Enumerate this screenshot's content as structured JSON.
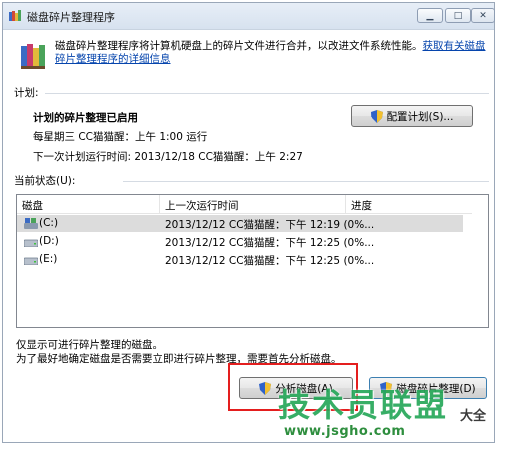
{
  "window": {
    "title": "磁盘碎片整理程序",
    "min_icon": "minimize-icon",
    "max_icon": "maximize-icon",
    "close_icon": "close-icon",
    "min_glyph": "▁",
    "max_glyph": "□",
    "close_glyph": "✕"
  },
  "intro": {
    "text": "磁盘碎片整理程序将计算机硬盘上的碎片文件进行合并，以改进文件系统性能。",
    "link": "获取有关磁盘碎片整理程序的详细信息"
  },
  "schedule": {
    "section_label": "计划:",
    "status": "计划的碎片整理已启用",
    "run_info": "每星期三  CC猫猫醒：上午 1:00 运行",
    "next_run": "下一次计划运行时间: 2013/12/18 CC猫猫醒：上午 2:27",
    "configure_button": "配置计划(S)..."
  },
  "current_status": {
    "section_label": "当前状态(U):",
    "columns": [
      "磁盘",
      "上一次运行时间",
      "进度"
    ],
    "rows": [
      {
        "drive": "(C:)",
        "last_run": "2013/12/12 CC猫猫醒：下午 12:19 (0%...",
        "progress": "",
        "icon": "system-drive-icon"
      },
      {
        "drive": "(D:)",
        "last_run": "2013/12/12 CC猫猫醒：下午 12:25 (0%...",
        "progress": "",
        "icon": "drive-icon"
      },
      {
        "drive": "(E:)",
        "last_run": "2013/12/12 CC猫猫醒：下午 12:25 (0%...",
        "progress": "",
        "icon": "drive-icon"
      }
    ]
  },
  "notes": {
    "line1": "仅显示可进行碎片整理的磁盘。",
    "line2": "为了最好地确定磁盘是否需要立即进行碎片整理，需要首先分析磁盘。"
  },
  "actions": {
    "analyze_button": "分析磁盘(A)",
    "defrag_button": "磁盘碎片整理(D)"
  },
  "watermark": {
    "big": "技术员联盟",
    "url": "www.jsgho.com",
    "side": "大全"
  },
  "colors": {
    "highlight": "#e41e1e",
    "link": "#0645ad",
    "watermark": "#27a85a"
  }
}
